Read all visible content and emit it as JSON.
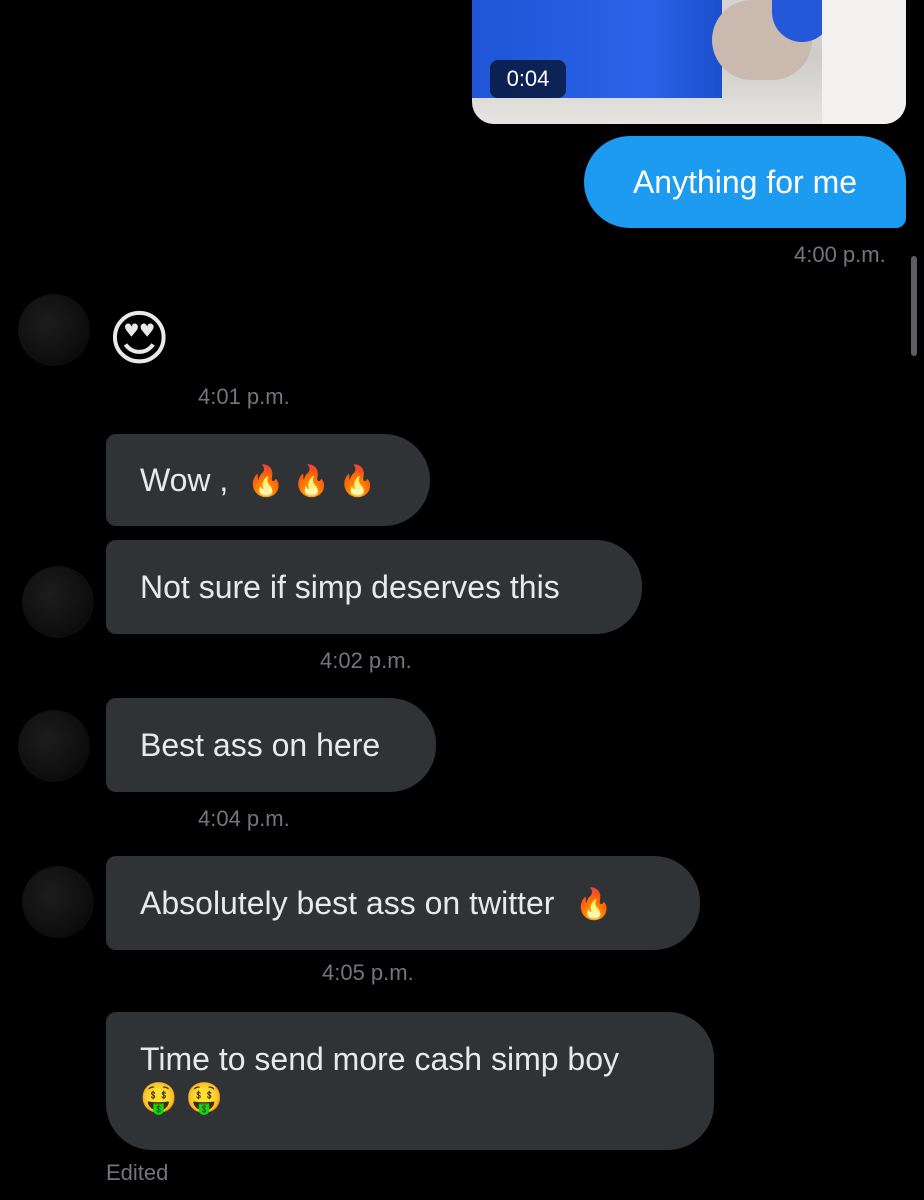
{
  "video": {
    "duration": "0:04"
  },
  "messages": {
    "outgoing": {
      "text": "Anything for me",
      "time": "4:00 p.m."
    },
    "reaction": {
      "emoji": "😍",
      "time": "4:01 p.m."
    },
    "wow": {
      "text": "Wow ,",
      "emoji": "🔥 🔥 🔥"
    },
    "not_sure": {
      "text": "Not sure if simp deserves this",
      "time": "4:02 p.m."
    },
    "best_ass": {
      "text": "Best ass on here",
      "time": "4:04 p.m."
    },
    "absolutely": {
      "text": "Absolutely best ass on twitter",
      "emoji": "🔥",
      "time": "4:05 p.m."
    },
    "time_to_send": {
      "line1": "Time to send more cash simp boy",
      "line2": "🤑 🤑",
      "status": "Edited"
    }
  },
  "colors": {
    "background": "#000000",
    "outgoing_bubble": "#1d9bf0",
    "incoming_bubble": "#2f3336",
    "timestamp": "#71767b"
  }
}
